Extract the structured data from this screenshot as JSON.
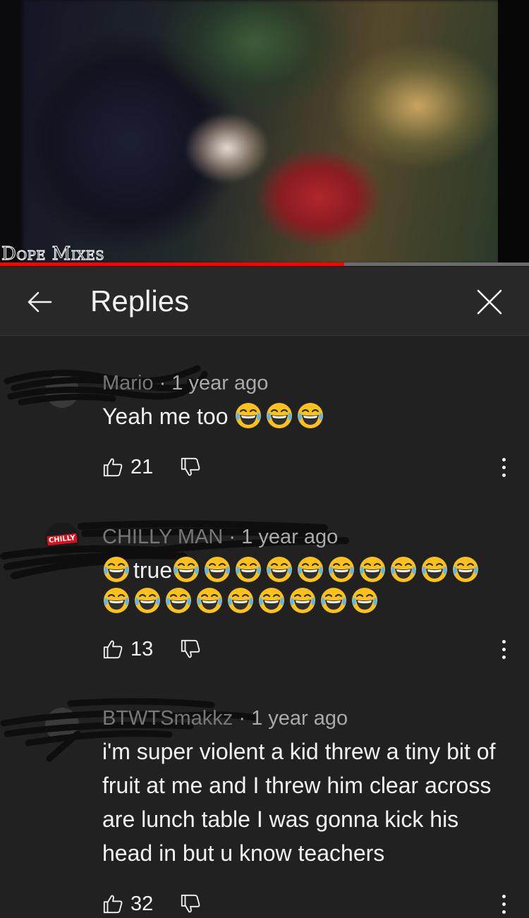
{
  "video": {
    "watermark": "Dope Mixes",
    "progress_percent": 65
  },
  "header": {
    "title": "Replies",
    "back_icon": "arrow-left-icon",
    "close_icon": "close-icon"
  },
  "colors": {
    "background": "#212121",
    "header_bg": "#282828",
    "progress": "#ff0000",
    "secondary_text": "#aaaaaa"
  },
  "comments": [
    {
      "author": "Mario",
      "time": "1 year ago",
      "text": "Yeah me too",
      "emoji_count": 3,
      "likes": "21"
    },
    {
      "author": "CHILLY MAN",
      "time": "1 year ago",
      "avatar_text": "CHILLY",
      "text_prefix_emoji_count": 1,
      "text": "true",
      "emoji_count": 19,
      "likes": "13"
    },
    {
      "author": "BTWTSmakkz",
      "time": "1 year ago",
      "text": "i'm super violent a kid threw a tiny bit of fruit at me and I threw him clear across are lunch table I was gonna kick his head in but u know teachers",
      "likes": "32"
    }
  ],
  "separator": " · "
}
